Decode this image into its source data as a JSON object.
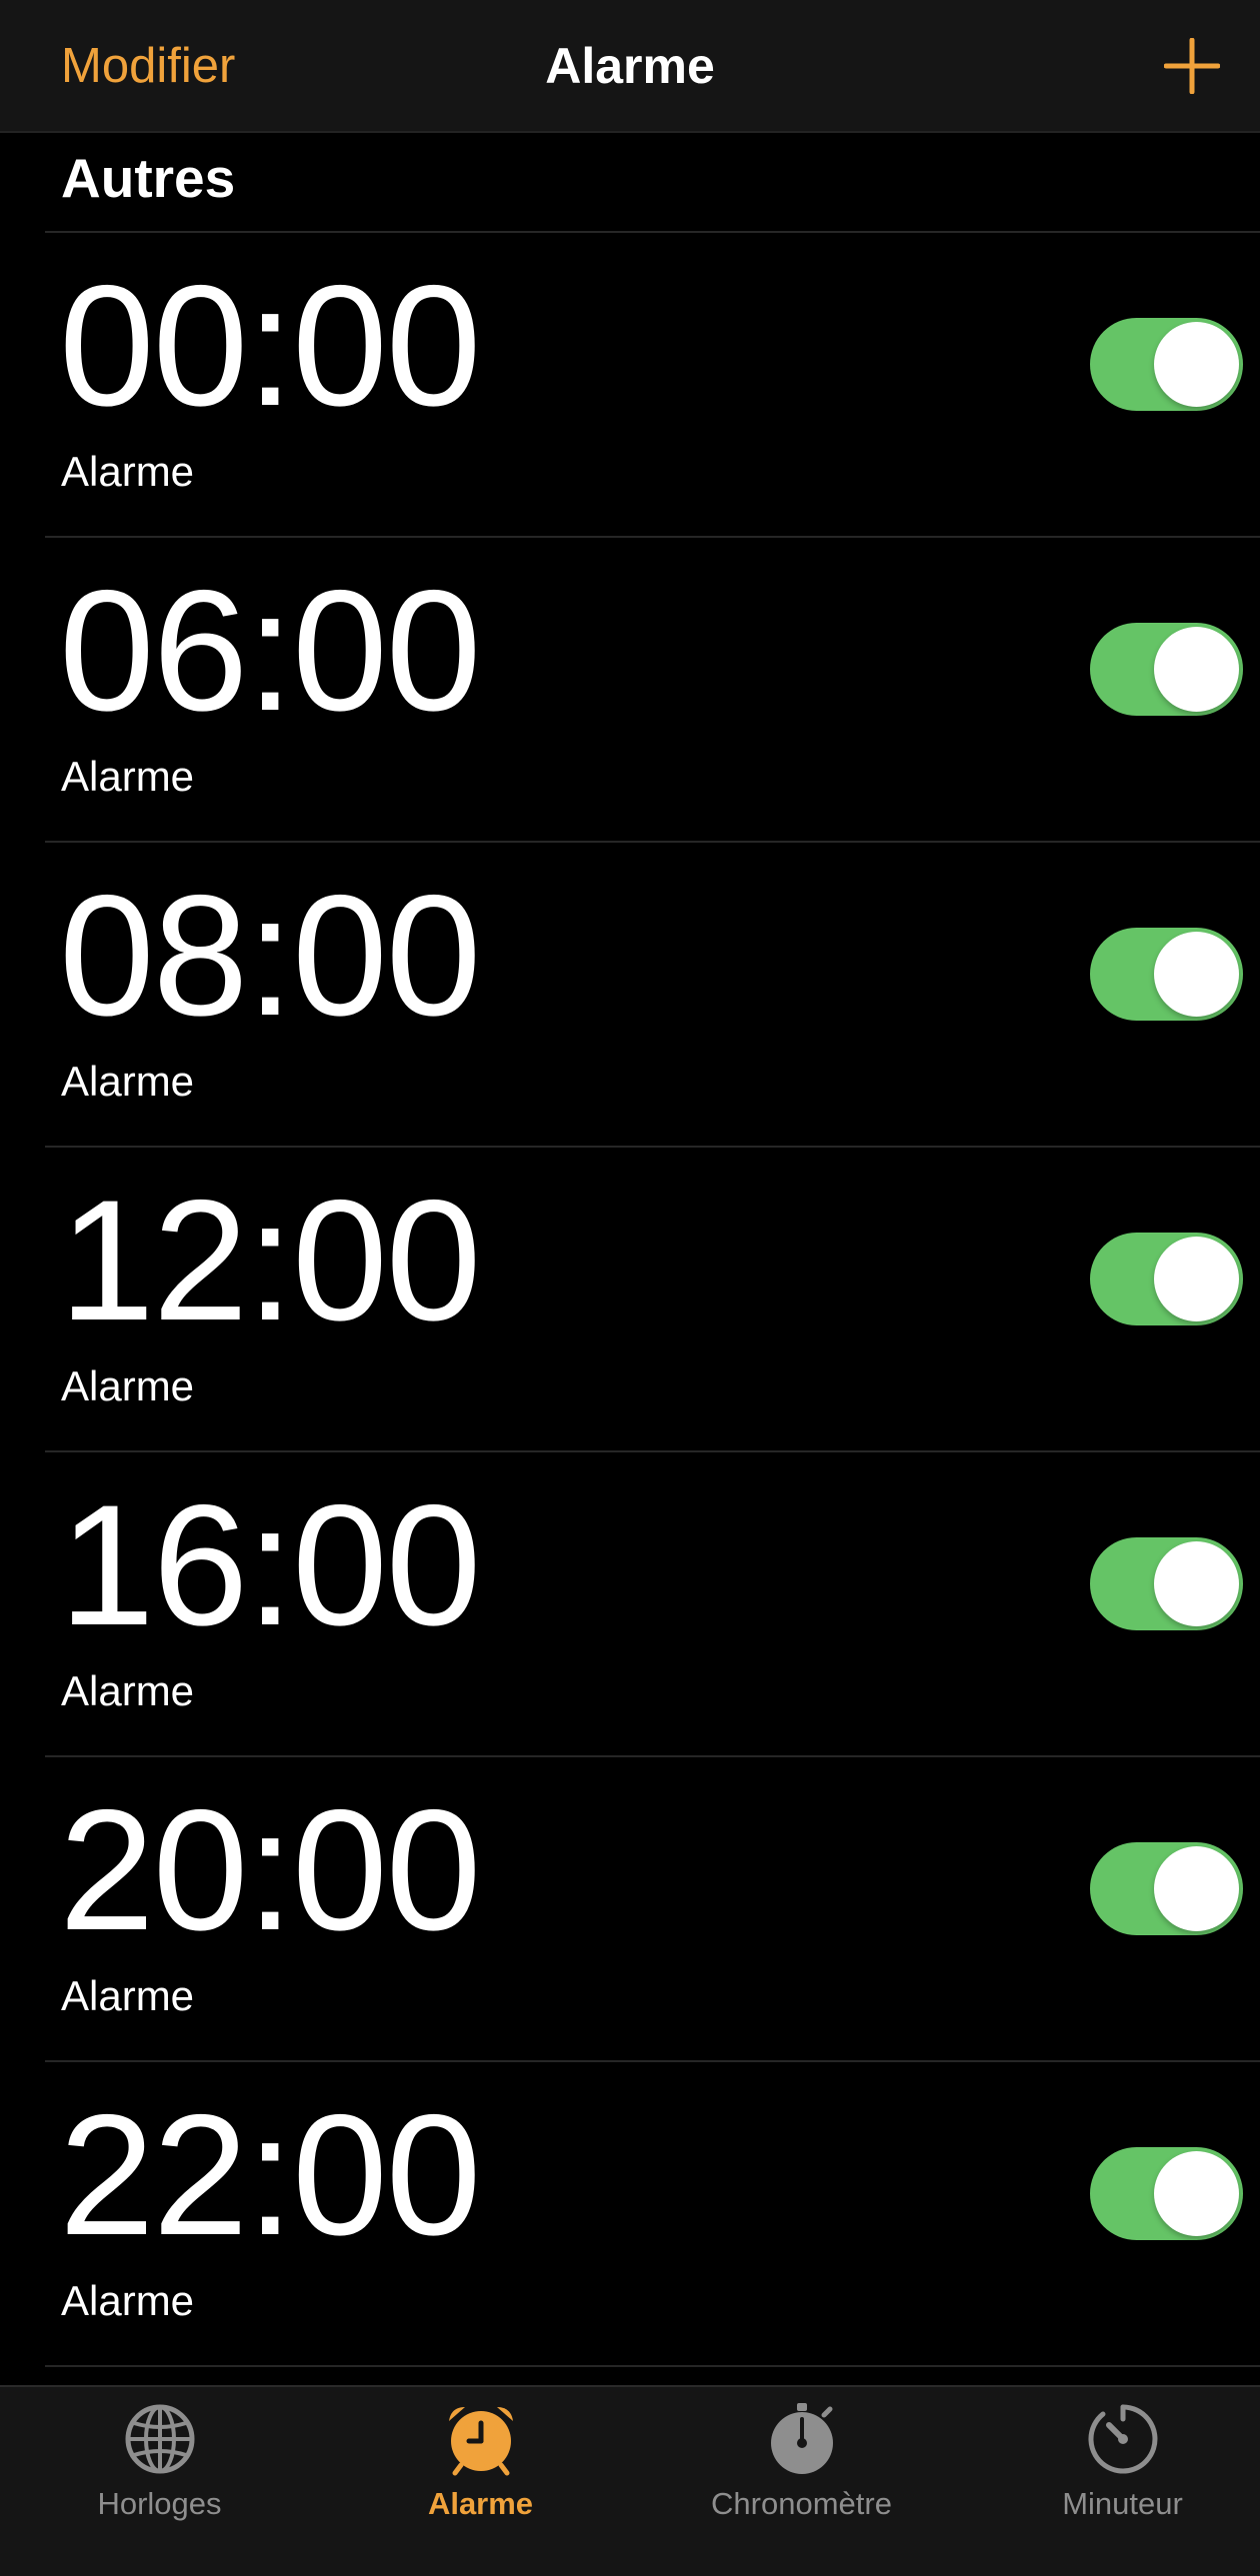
{
  "nav": {
    "edit_label": "Modifier",
    "title": "Alarme",
    "add_icon": "plus-icon"
  },
  "section": {
    "title": "Autres"
  },
  "alarms": [
    {
      "time": "00:00",
      "label": "Alarme",
      "enabled": true
    },
    {
      "time": "06:00",
      "label": "Alarme",
      "enabled": true
    },
    {
      "time": "08:00",
      "label": "Alarme",
      "enabled": true
    },
    {
      "time": "12:00",
      "label": "Alarme",
      "enabled": true
    },
    {
      "time": "16:00",
      "label": "Alarme",
      "enabled": true
    },
    {
      "time": "20:00",
      "label": "Alarme",
      "enabled": true
    },
    {
      "time": "22:00",
      "label": "Alarme",
      "enabled": true
    }
  ],
  "tabs": [
    {
      "label": "Horloges",
      "icon": "globe-icon",
      "active": false
    },
    {
      "label": "Alarme",
      "icon": "alarm-clock-icon",
      "active": true
    },
    {
      "label": "Chronomètre",
      "icon": "stopwatch-icon",
      "active": false
    },
    {
      "label": "Minuteur",
      "icon": "timer-icon",
      "active": false
    }
  ],
  "colors": {
    "accent": "#f0a23b",
    "toggle_on": "#65c466",
    "background": "#000000",
    "bar_background": "#151515",
    "tab_inactive": "#8e8e8e"
  }
}
